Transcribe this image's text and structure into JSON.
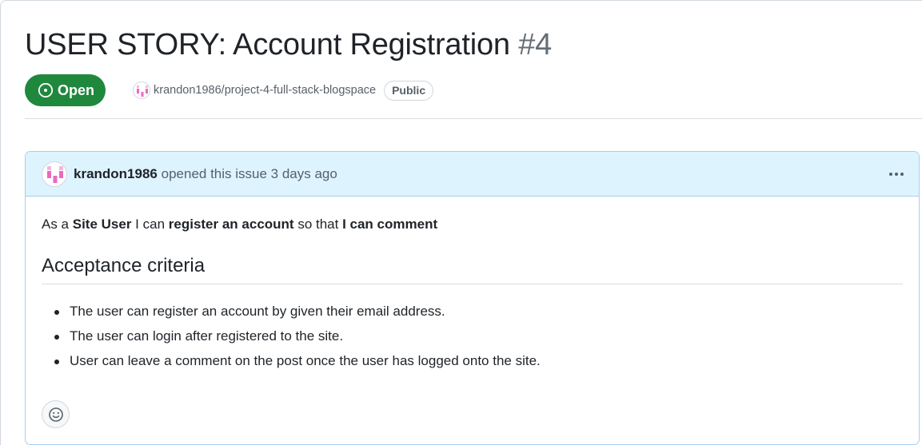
{
  "issue": {
    "title": "USER STORY: Account Registration",
    "number": "#4",
    "state": "Open",
    "repo": "krandon1986/project-4-full-stack-blogspace",
    "visibility": "Public"
  },
  "comment": {
    "author": "krandon1986",
    "action": "opened this issue 3 days ago",
    "story": {
      "p1": "As a ",
      "role": "Site User",
      "p2": " I can ",
      "goal": "register an account",
      "p3": " so that ",
      "benefit": "I can comment"
    },
    "heading": "Acceptance criteria",
    "criteria": [
      "The user can register an account by given their email address.",
      "The user can login after registered to the site.",
      "User can leave a comment on the post once the user has logged onto the site."
    ]
  },
  "icons": {
    "state": "issue-opened-icon",
    "menu": "kebab-horizontal-icon",
    "reaction": "smiley-icon"
  },
  "colors": {
    "open_badge": "#1f883d",
    "comment_header_bg": "#ddf4ff",
    "comment_border": "#a9cdf0",
    "muted_text": "#57606a",
    "avatar_accent": "#e86ac0"
  }
}
